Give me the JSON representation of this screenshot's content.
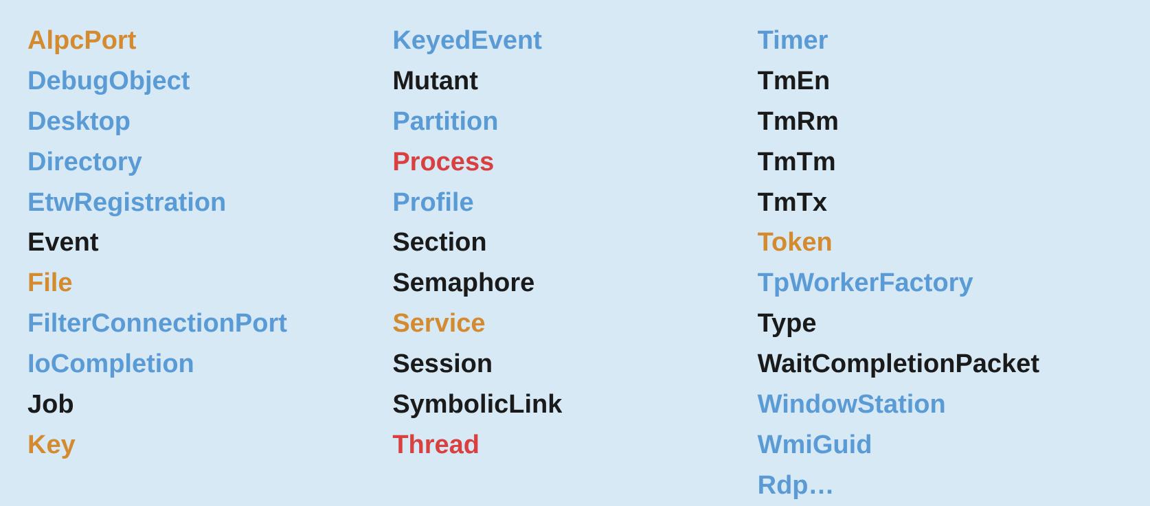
{
  "columns": [
    {
      "id": "col1",
      "items": [
        {
          "label": "AlpcPort",
          "color": "orange"
        },
        {
          "label": "DebugObject",
          "color": "blue"
        },
        {
          "label": "Desktop",
          "color": "blue"
        },
        {
          "label": "Directory",
          "color": "blue"
        },
        {
          "label": "EtwRegistration",
          "color": "blue"
        },
        {
          "label": "Event",
          "color": "black"
        },
        {
          "label": "File",
          "color": "orange"
        },
        {
          "label": "FilterConnectionPort",
          "color": "blue"
        },
        {
          "label": "IoCompletion",
          "color": "blue"
        },
        {
          "label": "Job",
          "color": "black"
        },
        {
          "label": "Key",
          "color": "orange"
        }
      ]
    },
    {
      "id": "col2",
      "items": [
        {
          "label": "KeyedEvent",
          "color": "blue"
        },
        {
          "label": "Mutant",
          "color": "black"
        },
        {
          "label": "Partition",
          "color": "blue"
        },
        {
          "label": "Process",
          "color": "red"
        },
        {
          "label": "Profile",
          "color": "blue"
        },
        {
          "label": "Section",
          "color": "black"
        },
        {
          "label": "Semaphore",
          "color": "black"
        },
        {
          "label": "Service",
          "color": "orange"
        },
        {
          "label": "Session",
          "color": "black"
        },
        {
          "label": "SymbolicLink",
          "color": "black"
        },
        {
          "label": "Thread",
          "color": "red"
        }
      ]
    },
    {
      "id": "col3",
      "items": [
        {
          "label": "Timer",
          "color": "blue"
        },
        {
          "label": "TmEn",
          "color": "black"
        },
        {
          "label": "TmRm",
          "color": "black"
        },
        {
          "label": "TmTm",
          "color": "black"
        },
        {
          "label": "TmTx",
          "color": "black"
        },
        {
          "label": "Token",
          "color": "orange"
        },
        {
          "label": "TpWorkerFactory",
          "color": "blue"
        },
        {
          "label": "Type",
          "color": "black"
        },
        {
          "label": "WaitCompletionPacket",
          "color": "black"
        },
        {
          "label": "WindowStation",
          "color": "blue"
        },
        {
          "label": "WmiGuid",
          "color": "blue"
        },
        {
          "label": "Rdp…",
          "color": "blue"
        }
      ]
    }
  ],
  "colors": {
    "orange": "#d48a2e",
    "blue": "#5b9bd5",
    "red": "#d94040",
    "black": "#1a1a1a"
  }
}
